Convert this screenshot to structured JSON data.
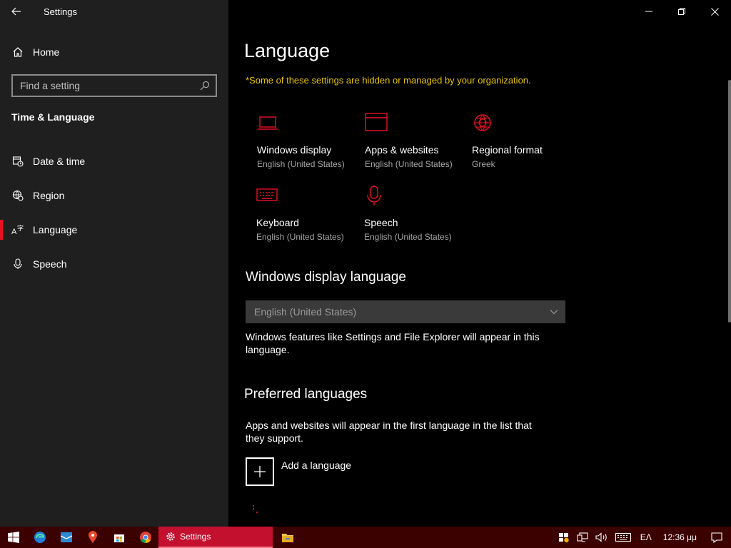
{
  "window": {
    "title": "Settings"
  },
  "sidebar": {
    "home_label": "Home",
    "search_placeholder": "Find a setting",
    "section_title": "Time & Language",
    "items": [
      {
        "label": "Date & time",
        "icon": "calendar-clock-icon",
        "selected": false
      },
      {
        "label": "Region",
        "icon": "globe-gear-icon",
        "selected": false
      },
      {
        "label": "Language",
        "icon": "language-icon",
        "selected": true
      },
      {
        "label": "Speech",
        "icon": "microphone-icon",
        "selected": false
      }
    ]
  },
  "main": {
    "title": "Language",
    "org_note": "*Some of these settings are hidden or managed by your organization.",
    "tiles": [
      {
        "name": "Windows display",
        "value": "English (United States)",
        "icon": "laptop-icon"
      },
      {
        "name": "Apps & websites",
        "value": "English (United States)",
        "icon": "browser-window-icon"
      },
      {
        "name": "Regional format",
        "value": "Greek",
        "icon": "globe-icon"
      },
      {
        "name": "Keyboard",
        "value": "English (United States)",
        "icon": "keyboard-icon"
      },
      {
        "name": "Speech",
        "value": "English (United States)",
        "icon": "microphone-icon"
      }
    ],
    "display_language": {
      "heading": "Windows display language",
      "selected": "English (United States)",
      "description": "Windows features like Settings and File Explorer will appear in this language."
    },
    "preferred": {
      "heading": "Preferred languages",
      "description": "Apps and websites will appear in the first language in the list that they support.",
      "add_label": "Add a language"
    }
  },
  "taskbar": {
    "active_app_label": "Settings",
    "input_indicator": "ΕΛ",
    "clock": "12:36 μμ"
  },
  "colors": {
    "accent": "#e81123",
    "warning": "#e8c500",
    "taskbar": "#3b0000",
    "taskbar_active": "#c4102f"
  }
}
